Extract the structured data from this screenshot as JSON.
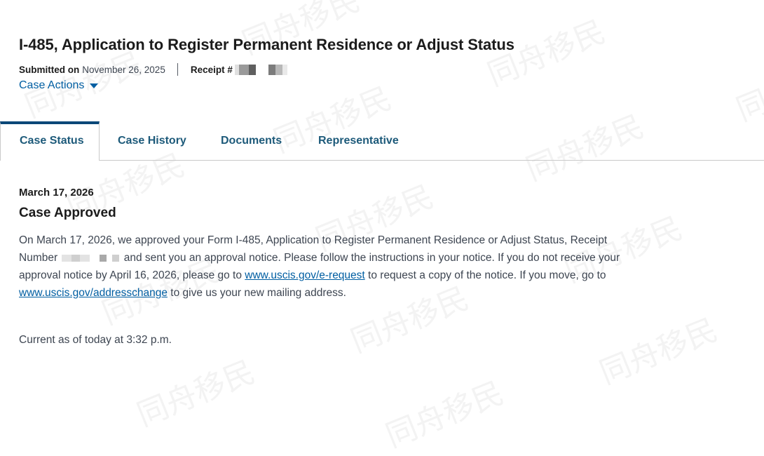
{
  "case": {
    "title": "I-485, Application to Register Permanent Residence or Adjust Status",
    "submitted_label": "Submitted on",
    "submitted_date": "November 26, 2025",
    "receipt_label": "Receipt #",
    "actions_label": "Case Actions"
  },
  "tabs": [
    {
      "label": "Case Status",
      "active": true
    },
    {
      "label": "Case History",
      "active": false
    },
    {
      "label": "Documents",
      "active": false
    },
    {
      "label": "Representative",
      "active": false
    }
  ],
  "status": {
    "date": "March 17, 2026",
    "title": "Case Approved",
    "body_part1": "On March 17, 2026, we approved your Form I-485, Application to Register Permanent Residence or Adjust Status, Receipt Number",
    "body_part2": "and sent you an approval notice. Please follow the instructions in your notice. If you do not receive your approval notice by April 16, 2026, please go to",
    "link1": "www.uscis.gov/e-request",
    "body_part3": "to request a copy of the notice. If you move, go to",
    "link2": "www.uscis.gov/addresschange",
    "body_part4": "to give us your new mailing address.",
    "updated": "Current as of today at 3:32 p.m."
  },
  "watermark_text": "同舟移民",
  "colors": {
    "link": "#005ea2",
    "tab_active_border": "#0b4778",
    "heading": "#1b1b1b",
    "body_text": "#3d4551"
  }
}
